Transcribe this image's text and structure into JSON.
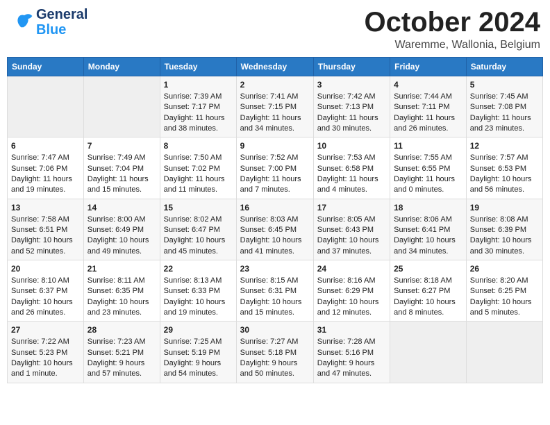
{
  "header": {
    "logo_general": "General",
    "logo_blue": "Blue",
    "month_title": "October 2024",
    "location": "Waremme, Wallonia, Belgium"
  },
  "days_of_week": [
    "Sunday",
    "Monday",
    "Tuesday",
    "Wednesday",
    "Thursday",
    "Friday",
    "Saturday"
  ],
  "weeks": [
    [
      {
        "day": "",
        "sunrise": "",
        "sunset": "",
        "daylight": "",
        "empty": true
      },
      {
        "day": "",
        "sunrise": "",
        "sunset": "",
        "daylight": "",
        "empty": true
      },
      {
        "day": "1",
        "sunrise": "Sunrise: 7:39 AM",
        "sunset": "Sunset: 7:17 PM",
        "daylight": "Daylight: 11 hours and 38 minutes."
      },
      {
        "day": "2",
        "sunrise": "Sunrise: 7:41 AM",
        "sunset": "Sunset: 7:15 PM",
        "daylight": "Daylight: 11 hours and 34 minutes."
      },
      {
        "day": "3",
        "sunrise": "Sunrise: 7:42 AM",
        "sunset": "Sunset: 7:13 PM",
        "daylight": "Daylight: 11 hours and 30 minutes."
      },
      {
        "day": "4",
        "sunrise": "Sunrise: 7:44 AM",
        "sunset": "Sunset: 7:11 PM",
        "daylight": "Daylight: 11 hours and 26 minutes."
      },
      {
        "day": "5",
        "sunrise": "Sunrise: 7:45 AM",
        "sunset": "Sunset: 7:08 PM",
        "daylight": "Daylight: 11 hours and 23 minutes."
      }
    ],
    [
      {
        "day": "6",
        "sunrise": "Sunrise: 7:47 AM",
        "sunset": "Sunset: 7:06 PM",
        "daylight": "Daylight: 11 hours and 19 minutes."
      },
      {
        "day": "7",
        "sunrise": "Sunrise: 7:49 AM",
        "sunset": "Sunset: 7:04 PM",
        "daylight": "Daylight: 11 hours and 15 minutes."
      },
      {
        "day": "8",
        "sunrise": "Sunrise: 7:50 AM",
        "sunset": "Sunset: 7:02 PM",
        "daylight": "Daylight: 11 hours and 11 minutes."
      },
      {
        "day": "9",
        "sunrise": "Sunrise: 7:52 AM",
        "sunset": "Sunset: 7:00 PM",
        "daylight": "Daylight: 11 hours and 7 minutes."
      },
      {
        "day": "10",
        "sunrise": "Sunrise: 7:53 AM",
        "sunset": "Sunset: 6:58 PM",
        "daylight": "Daylight: 11 hours and 4 minutes."
      },
      {
        "day": "11",
        "sunrise": "Sunrise: 7:55 AM",
        "sunset": "Sunset: 6:55 PM",
        "daylight": "Daylight: 11 hours and 0 minutes."
      },
      {
        "day": "12",
        "sunrise": "Sunrise: 7:57 AM",
        "sunset": "Sunset: 6:53 PM",
        "daylight": "Daylight: 10 hours and 56 minutes."
      }
    ],
    [
      {
        "day": "13",
        "sunrise": "Sunrise: 7:58 AM",
        "sunset": "Sunset: 6:51 PM",
        "daylight": "Daylight: 10 hours and 52 minutes."
      },
      {
        "day": "14",
        "sunrise": "Sunrise: 8:00 AM",
        "sunset": "Sunset: 6:49 PM",
        "daylight": "Daylight: 10 hours and 49 minutes."
      },
      {
        "day": "15",
        "sunrise": "Sunrise: 8:02 AM",
        "sunset": "Sunset: 6:47 PM",
        "daylight": "Daylight: 10 hours and 45 minutes."
      },
      {
        "day": "16",
        "sunrise": "Sunrise: 8:03 AM",
        "sunset": "Sunset: 6:45 PM",
        "daylight": "Daylight: 10 hours and 41 minutes."
      },
      {
        "day": "17",
        "sunrise": "Sunrise: 8:05 AM",
        "sunset": "Sunset: 6:43 PM",
        "daylight": "Daylight: 10 hours and 37 minutes."
      },
      {
        "day": "18",
        "sunrise": "Sunrise: 8:06 AM",
        "sunset": "Sunset: 6:41 PM",
        "daylight": "Daylight: 10 hours and 34 minutes."
      },
      {
        "day": "19",
        "sunrise": "Sunrise: 8:08 AM",
        "sunset": "Sunset: 6:39 PM",
        "daylight": "Daylight: 10 hours and 30 minutes."
      }
    ],
    [
      {
        "day": "20",
        "sunrise": "Sunrise: 8:10 AM",
        "sunset": "Sunset: 6:37 PM",
        "daylight": "Daylight: 10 hours and 26 minutes."
      },
      {
        "day": "21",
        "sunrise": "Sunrise: 8:11 AM",
        "sunset": "Sunset: 6:35 PM",
        "daylight": "Daylight: 10 hours and 23 minutes."
      },
      {
        "day": "22",
        "sunrise": "Sunrise: 8:13 AM",
        "sunset": "Sunset: 6:33 PM",
        "daylight": "Daylight: 10 hours and 19 minutes."
      },
      {
        "day": "23",
        "sunrise": "Sunrise: 8:15 AM",
        "sunset": "Sunset: 6:31 PM",
        "daylight": "Daylight: 10 hours and 15 minutes."
      },
      {
        "day": "24",
        "sunrise": "Sunrise: 8:16 AM",
        "sunset": "Sunset: 6:29 PM",
        "daylight": "Daylight: 10 hours and 12 minutes."
      },
      {
        "day": "25",
        "sunrise": "Sunrise: 8:18 AM",
        "sunset": "Sunset: 6:27 PM",
        "daylight": "Daylight: 10 hours and 8 minutes."
      },
      {
        "day": "26",
        "sunrise": "Sunrise: 8:20 AM",
        "sunset": "Sunset: 6:25 PM",
        "daylight": "Daylight: 10 hours and 5 minutes."
      }
    ],
    [
      {
        "day": "27",
        "sunrise": "Sunrise: 7:22 AM",
        "sunset": "Sunset: 5:23 PM",
        "daylight": "Daylight: 10 hours and 1 minute."
      },
      {
        "day": "28",
        "sunrise": "Sunrise: 7:23 AM",
        "sunset": "Sunset: 5:21 PM",
        "daylight": "Daylight: 9 hours and 57 minutes."
      },
      {
        "day": "29",
        "sunrise": "Sunrise: 7:25 AM",
        "sunset": "Sunset: 5:19 PM",
        "daylight": "Daylight: 9 hours and 54 minutes."
      },
      {
        "day": "30",
        "sunrise": "Sunrise: 7:27 AM",
        "sunset": "Sunset: 5:18 PM",
        "daylight": "Daylight: 9 hours and 50 minutes."
      },
      {
        "day": "31",
        "sunrise": "Sunrise: 7:28 AM",
        "sunset": "Sunset: 5:16 PM",
        "daylight": "Daylight: 9 hours and 47 minutes."
      },
      {
        "day": "",
        "sunrise": "",
        "sunset": "",
        "daylight": "",
        "empty": true
      },
      {
        "day": "",
        "sunrise": "",
        "sunset": "",
        "daylight": "",
        "empty": true
      }
    ]
  ]
}
